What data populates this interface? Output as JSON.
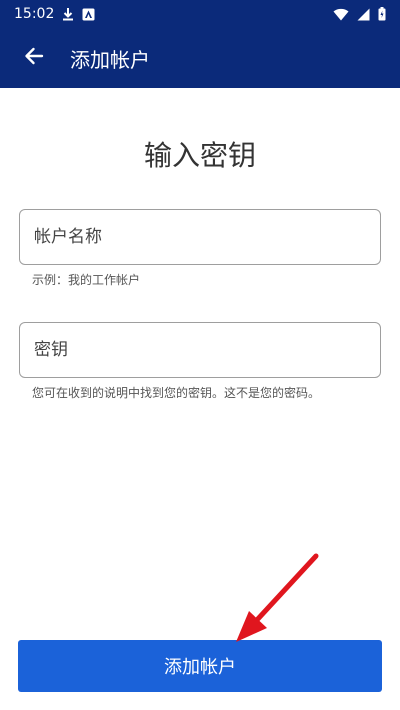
{
  "status_bar": {
    "time": "15:02",
    "icons": [
      "download-icon",
      "app-notification-icon",
      "wifi-icon",
      "signal-icon",
      "battery-icon"
    ]
  },
  "app_bar": {
    "title": "添加帐户",
    "back_icon": "arrow-left-icon"
  },
  "form": {
    "title": "输入密钥",
    "account_name": {
      "placeholder": "帐户名称",
      "helper": "示例：我的工作帐户"
    },
    "secret_key": {
      "placeholder": "密钥",
      "helper": "您可在收到的说明中找到您的密钥。这不是您的密码。"
    }
  },
  "actions": {
    "add_account_label": "添加帐户"
  },
  "colors": {
    "header": "#0b2a7a",
    "primary_button": "#1b62d9",
    "annotation_arrow": "#e0161e"
  }
}
